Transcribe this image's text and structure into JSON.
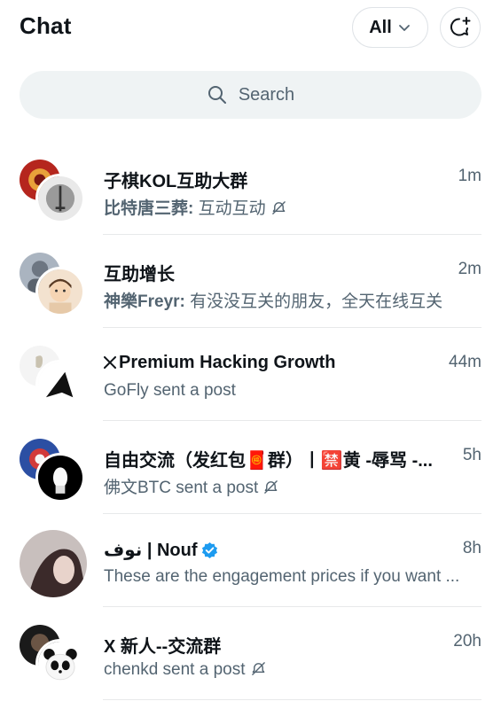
{
  "header": {
    "title": "Chat",
    "filter_label": "All",
    "compose_icon": "new-message-icon"
  },
  "search": {
    "placeholder": "Search",
    "icon": "search-icon"
  },
  "colors": {
    "text": "#0f1419",
    "secondary": "#536471",
    "search_bg": "#eff3f4",
    "verified": "#1d9bf0",
    "divider": "#e7e9ea"
  },
  "chats": [
    {
      "name": "子棋KOL互助大群",
      "time": "1m",
      "sender": "比特唐三葬:",
      "message": "互动互动",
      "muted": true
    },
    {
      "name": "互助增长",
      "time": "2m",
      "sender": "神樂Freyr:",
      "message": "有没没互关的朋友，全天在线互关",
      "muted": false
    },
    {
      "name": "Premium Hacking Growth",
      "name_prefix_icon": "x-logo-icon",
      "time": "44m",
      "sender": "",
      "message": "GoFly sent a post",
      "muted": false
    },
    {
      "name": "自由交流（发红包🧧群）丨🈲黄 -辱骂 -...",
      "time": "5h",
      "sender": "",
      "message": "佛文BTC sent a post",
      "muted": true
    },
    {
      "name": "نوف | Nouf",
      "verified": true,
      "time": "8h",
      "sender": "",
      "message": "These are the engagement prices if you want ...",
      "muted": false
    },
    {
      "name": "X 新人--交流群",
      "time": "20h",
      "sender": "",
      "message": "chenkd sent a post",
      "muted": true
    }
  ]
}
